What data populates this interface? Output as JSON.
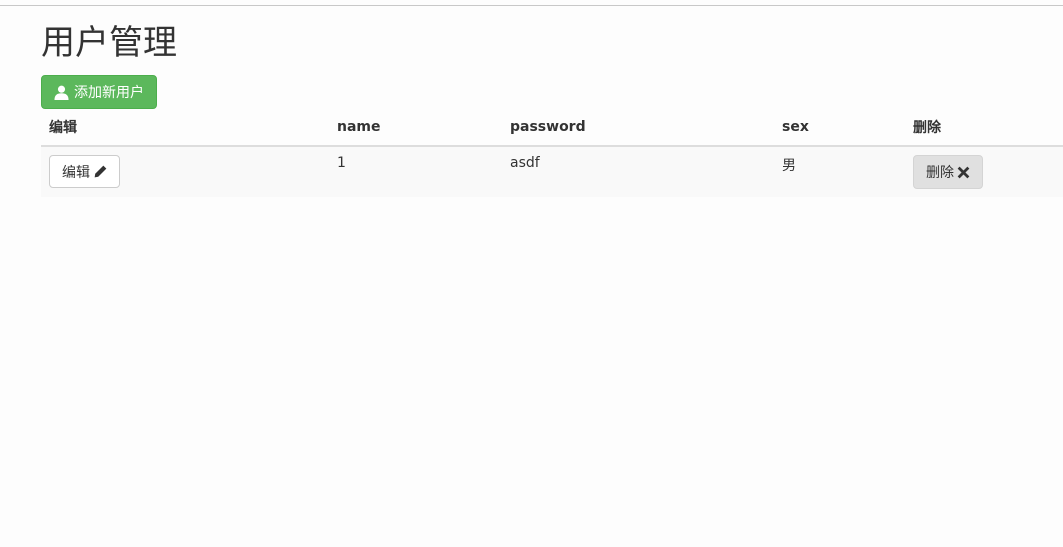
{
  "page": {
    "title": "用户管理"
  },
  "toolbar": {
    "add_user_label": "添加新用户",
    "add_user_icon": "user-icon"
  },
  "table": {
    "headers": {
      "edit": "编辑",
      "name": "name",
      "password": "password",
      "sex": "sex",
      "delete": "删除"
    },
    "rows": [
      {
        "edit_label": "编辑",
        "name": "1",
        "password": "asdf",
        "sex": "男",
        "delete_label": "删除"
      }
    ]
  },
  "colors": {
    "success": "#5cb85c",
    "delete_button_bg": "#e0e0e0",
    "border": "#dddddd"
  }
}
